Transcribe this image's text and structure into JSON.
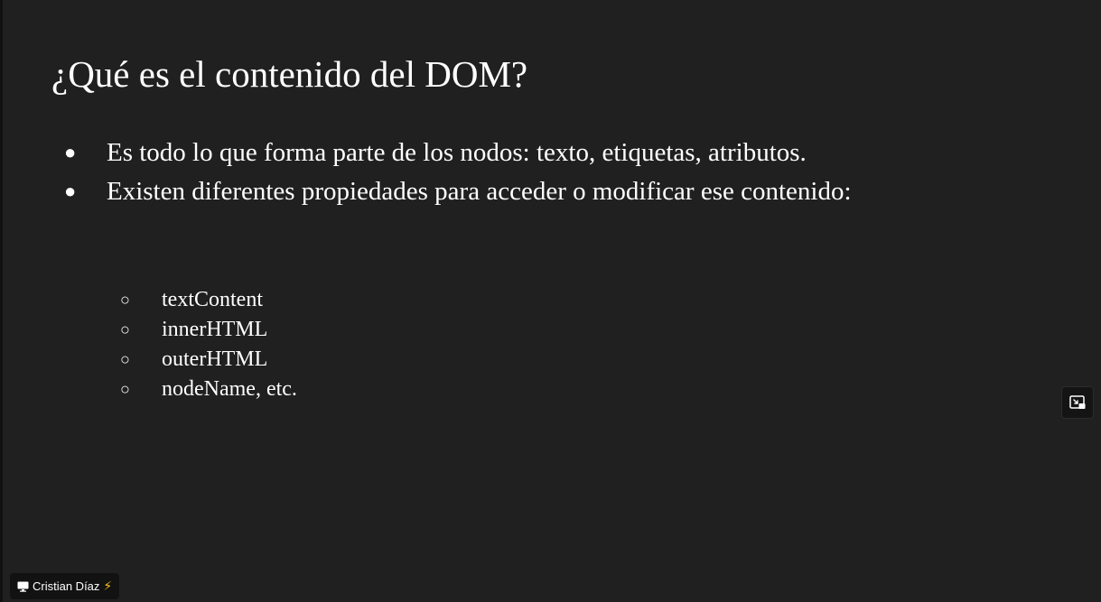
{
  "slide": {
    "title": "¿Qué es el contenido del DOM?",
    "bullets": [
      {
        "mark": "●",
        "text": "Es todo lo que forma parte de los nodos: texto, etiquetas, atributos."
      },
      {
        "mark": "●",
        "text": "Existen diferentes propiedades para acceder o modificar ese contenido:"
      }
    ],
    "subbullets": [
      {
        "mark": "○",
        "text": "textContent"
      },
      {
        "mark": "○",
        "text": "innerHTML"
      },
      {
        "mark": "○",
        "text": "outerHTML"
      },
      {
        "mark": "○",
        "text": "nodeName, etc."
      }
    ]
  },
  "controls": {
    "pip_icon": "picture-in-picture-icon"
  },
  "presenter": {
    "name": "Cristian Díaz",
    "screen_icon": "screen-share-icon",
    "badge_glyph": "⚡",
    "badge_color": "#f5c518"
  },
  "colors": {
    "background": "#202020",
    "text": "#ffffff"
  }
}
